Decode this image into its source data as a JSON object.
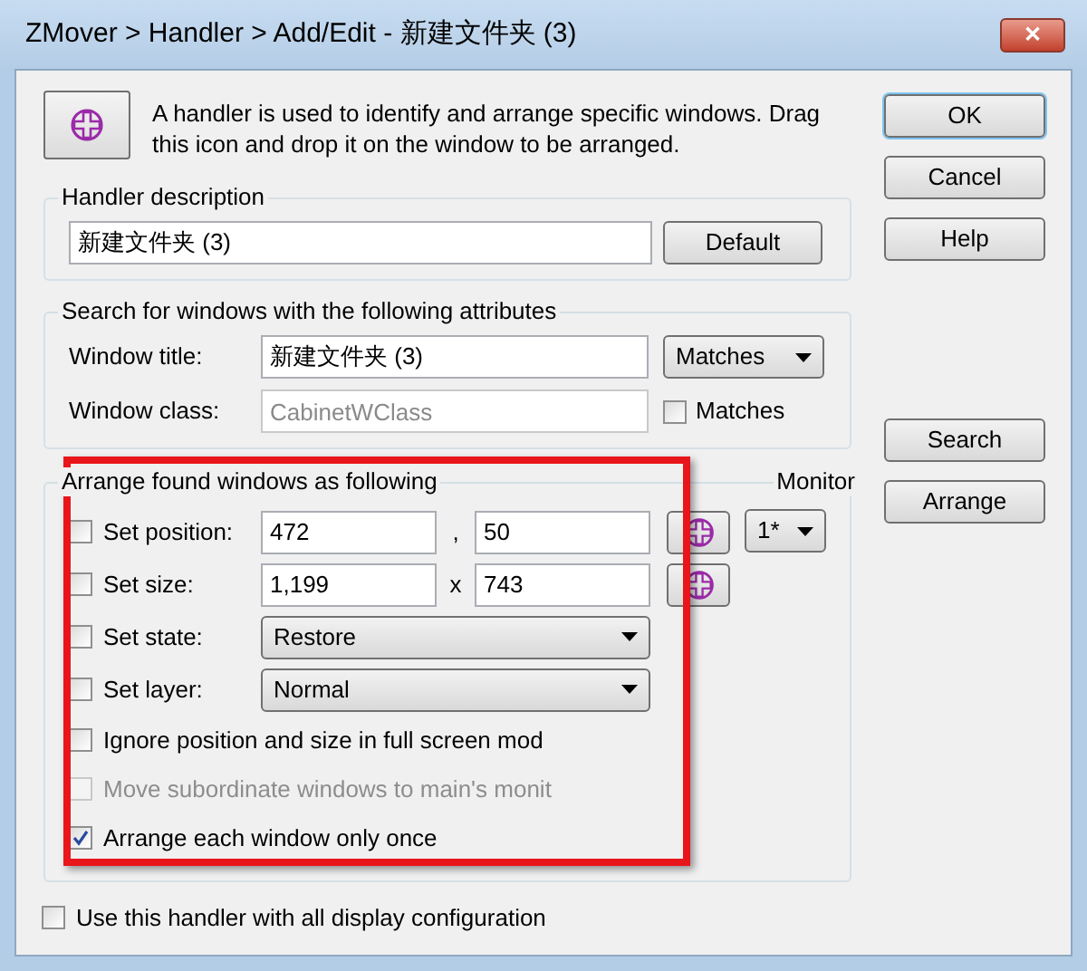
{
  "window": {
    "title": "ZMover > Handler > Add/Edit - 新建文件夹 (3)",
    "close": "✕"
  },
  "intro": "A handler is used to identify and arrange specific windows. Drag this icon and drop it on the window to be arranged.",
  "handler_description": {
    "label": "Handler description",
    "value": "新建文件夹 (3)",
    "button": "Default"
  },
  "search": {
    "label": "Search for windows with the following attributes",
    "window_title": {
      "label": "Window title:",
      "value": "新建文件夹 (3)",
      "select": "Matches"
    },
    "window_class": {
      "label": "Window class:",
      "value": "CabinetWClass",
      "disabled": true,
      "checkbox": {
        "label": "Matches",
        "checked": false
      }
    }
  },
  "arrange": {
    "label": "Arrange found windows as following",
    "monitor": {
      "label": "Monitor",
      "value": "1*"
    },
    "rows": [
      {
        "kind": "pair",
        "label": "Set position:",
        "checked": false,
        "first": "472",
        "separator": ",",
        "second": "50"
      },
      {
        "kind": "pair",
        "label": "Set size:",
        "checked": false,
        "first": "1,199",
        "separator": "x",
        "second": "743"
      },
      {
        "kind": "select",
        "label": "Set state:",
        "checked": false,
        "value": "Restore"
      },
      {
        "kind": "select",
        "label": "Set layer:",
        "checked": false,
        "value": "Normal"
      },
      {
        "kind": "check",
        "label": "Ignore position and size in full screen mod",
        "checked": false,
        "disabled": false
      },
      {
        "kind": "check",
        "label": "Move subordinate windows to main's monit",
        "checked": false,
        "disabled": true
      },
      {
        "kind": "check",
        "label": "Arrange each window only once",
        "checked": true,
        "disabled": false
      }
    ]
  },
  "bottom_checkbox": {
    "label": "Use this handler with all display configuration",
    "checked": false
  },
  "buttons": [
    {
      "label": "OK",
      "default": true
    },
    {
      "label": "Cancel",
      "default": false
    },
    {
      "label": "Help",
      "default": false
    }
  ],
  "action_buttons": [
    {
      "label": "Search"
    },
    {
      "label": "Arrange"
    }
  ]
}
